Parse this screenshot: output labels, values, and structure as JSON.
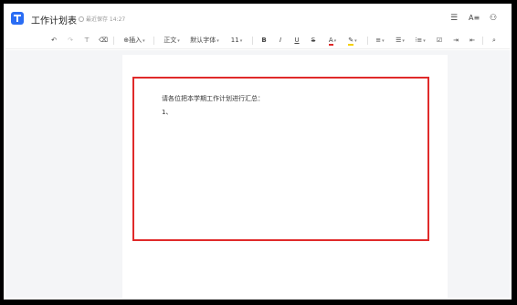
{
  "header": {
    "doc_title": "工作计划表",
    "save_status": "最近保存 14:27"
  },
  "toolbar": {
    "insert_label": "插入",
    "paragraph_style": "正文",
    "font_family": "默认字体",
    "font_size": "11",
    "bold": "B",
    "italic": "I",
    "underline": "U",
    "strikethrough": "S",
    "font_color": "A"
  },
  "colors": {
    "accent": "#2a6df4",
    "highlight_border": "#e02a2a",
    "font_color_bar": "#e02a2a",
    "highlight_color_bar": "#f5d000"
  },
  "document": {
    "lines": [
      "请各位把本学期工作计划进行汇总：",
      "1、"
    ]
  }
}
